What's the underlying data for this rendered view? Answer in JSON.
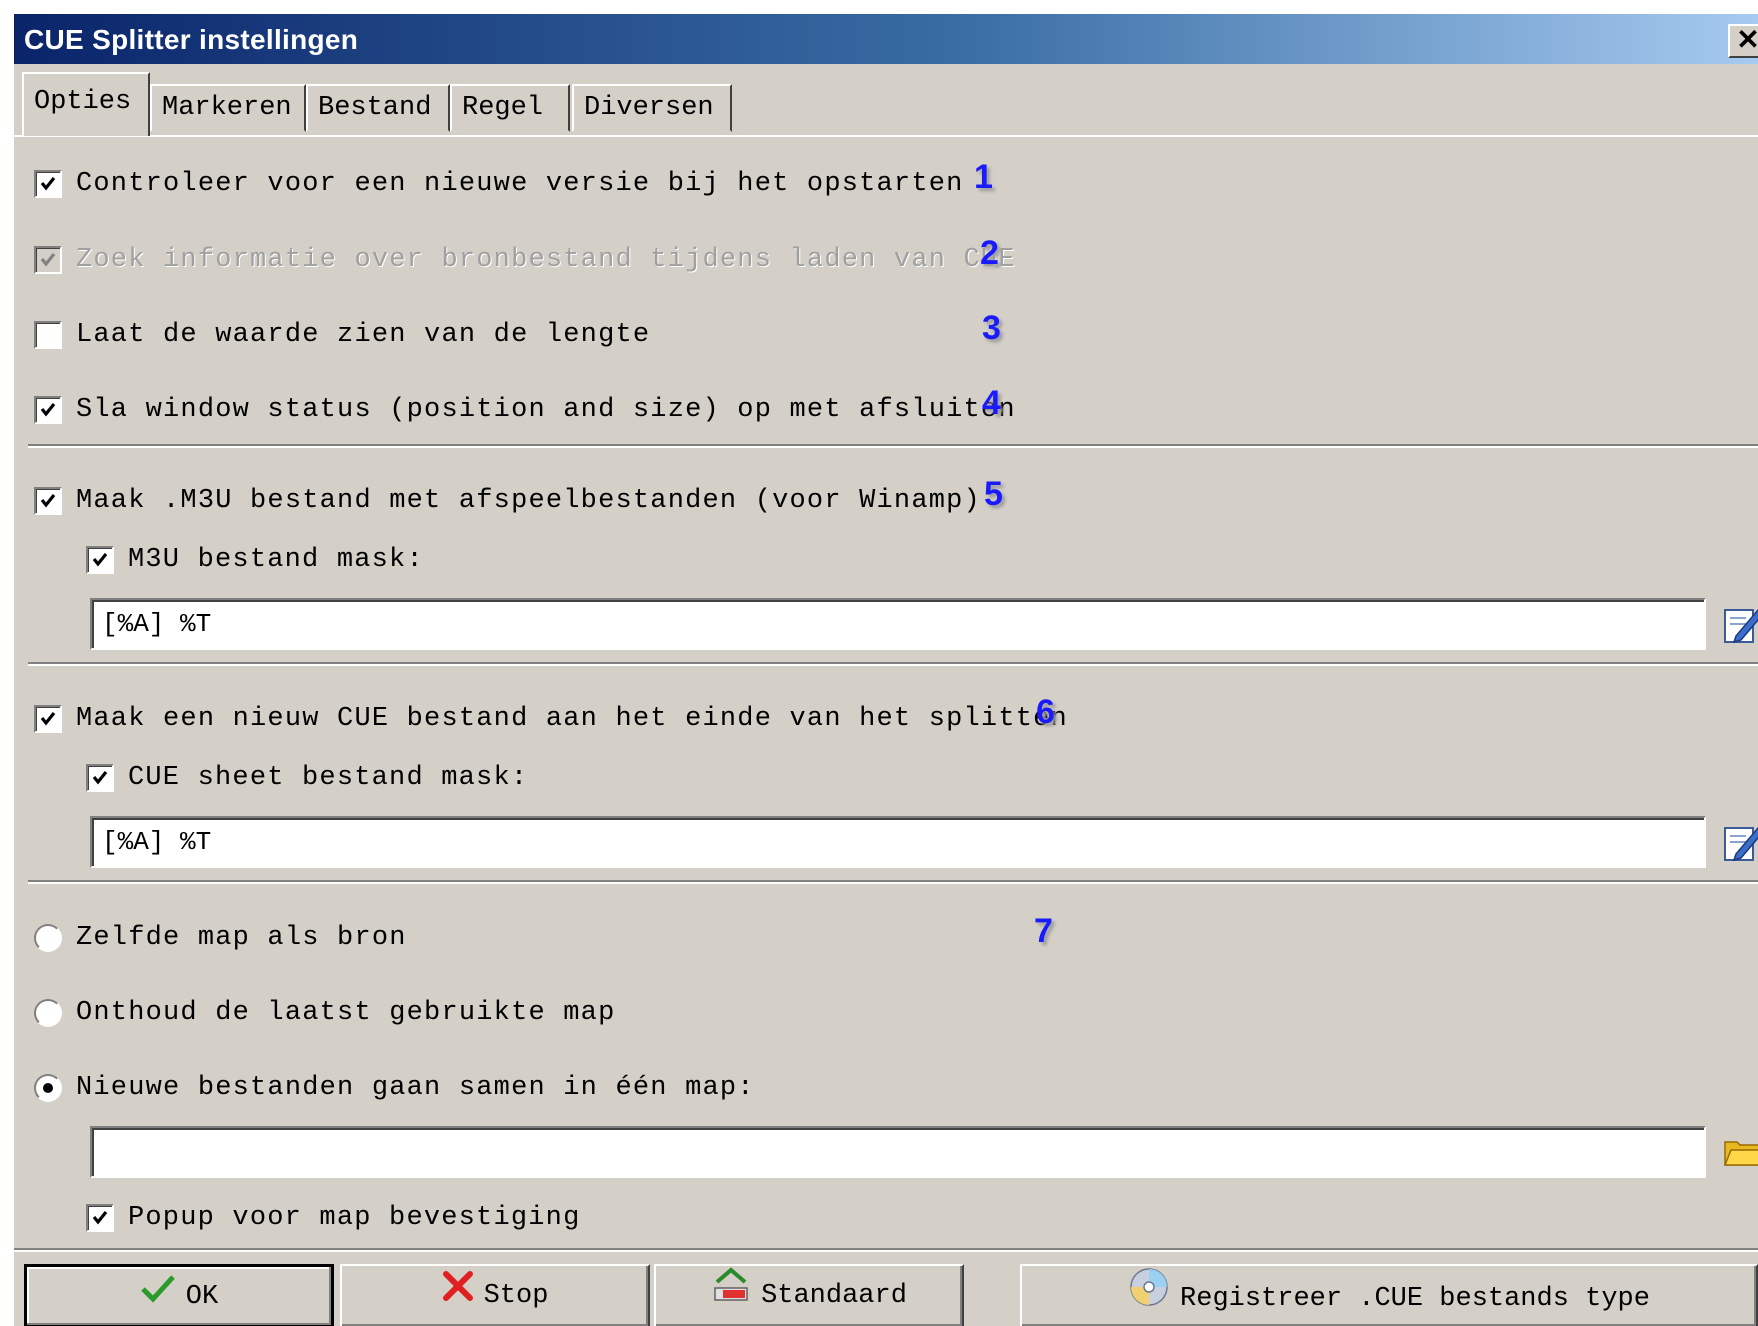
{
  "window": {
    "title": "CUE Splitter instellingen",
    "close_label": "✕"
  },
  "tabs": [
    {
      "label": "Opties",
      "active": true
    },
    {
      "label": "Markeren"
    },
    {
      "label": "Bestand"
    },
    {
      "label": "Regel"
    },
    {
      "label": "Diversen"
    }
  ],
  "options": {
    "check_update": {
      "label": "Controleer voor een nieuwe versie bij het opstarten",
      "checked": true,
      "marker": "1"
    },
    "search_info": {
      "label": "Zoek informatie over bronbestand tijdens laden van CUE",
      "checked": true,
      "disabled": true,
      "marker": "2"
    },
    "show_length": {
      "label": "Laat de waarde zien van de lengte",
      "checked": false,
      "marker": "3"
    },
    "save_window": {
      "label": "Sla window status (position and size) op met afsluiten",
      "checked": true,
      "marker": "4"
    }
  },
  "m3u": {
    "create": {
      "label": "Maak .M3U bestand met afspeelbestanden (voor Winamp)",
      "checked": true,
      "marker": "5"
    },
    "mask": {
      "label": "M3U bestand mask:",
      "checked": true
    },
    "mask_value": "[%A] %T",
    "edit_icon": "edit-pencil-icon"
  },
  "cue": {
    "create": {
      "label": "Maak een nieuw CUE bestand aan het einde van het splitten",
      "checked": true,
      "marker": "6"
    },
    "mask": {
      "label": "CUE sheet bestand mask:",
      "checked": true
    },
    "mask_value": "[%A] %T",
    "edit_icon": "edit-pencil-icon"
  },
  "folder": {
    "marker": "7",
    "same_as_source": {
      "label": "Zelfde map als bron",
      "selected": false
    },
    "remember_last": {
      "label": "Onthoud de laatst gebruikte map",
      "selected": false
    },
    "single_folder": {
      "label": "Nieuwe bestanden gaan samen in één map:",
      "selected": true
    },
    "path_value": "",
    "browse_icon": "folder-icon",
    "popup_confirm": {
      "label": "Popup voor map bevestiging",
      "checked": true
    }
  },
  "buttons": {
    "ok": "OK",
    "stop": "Stop",
    "default": "Standaard",
    "register": "Registreer .CUE bestands type"
  },
  "colors": {
    "marker_blue": "#1a1aff",
    "title_start": "#0a246a",
    "title_end": "#a6caf0",
    "dialog_bg": "#d4d0c8"
  }
}
